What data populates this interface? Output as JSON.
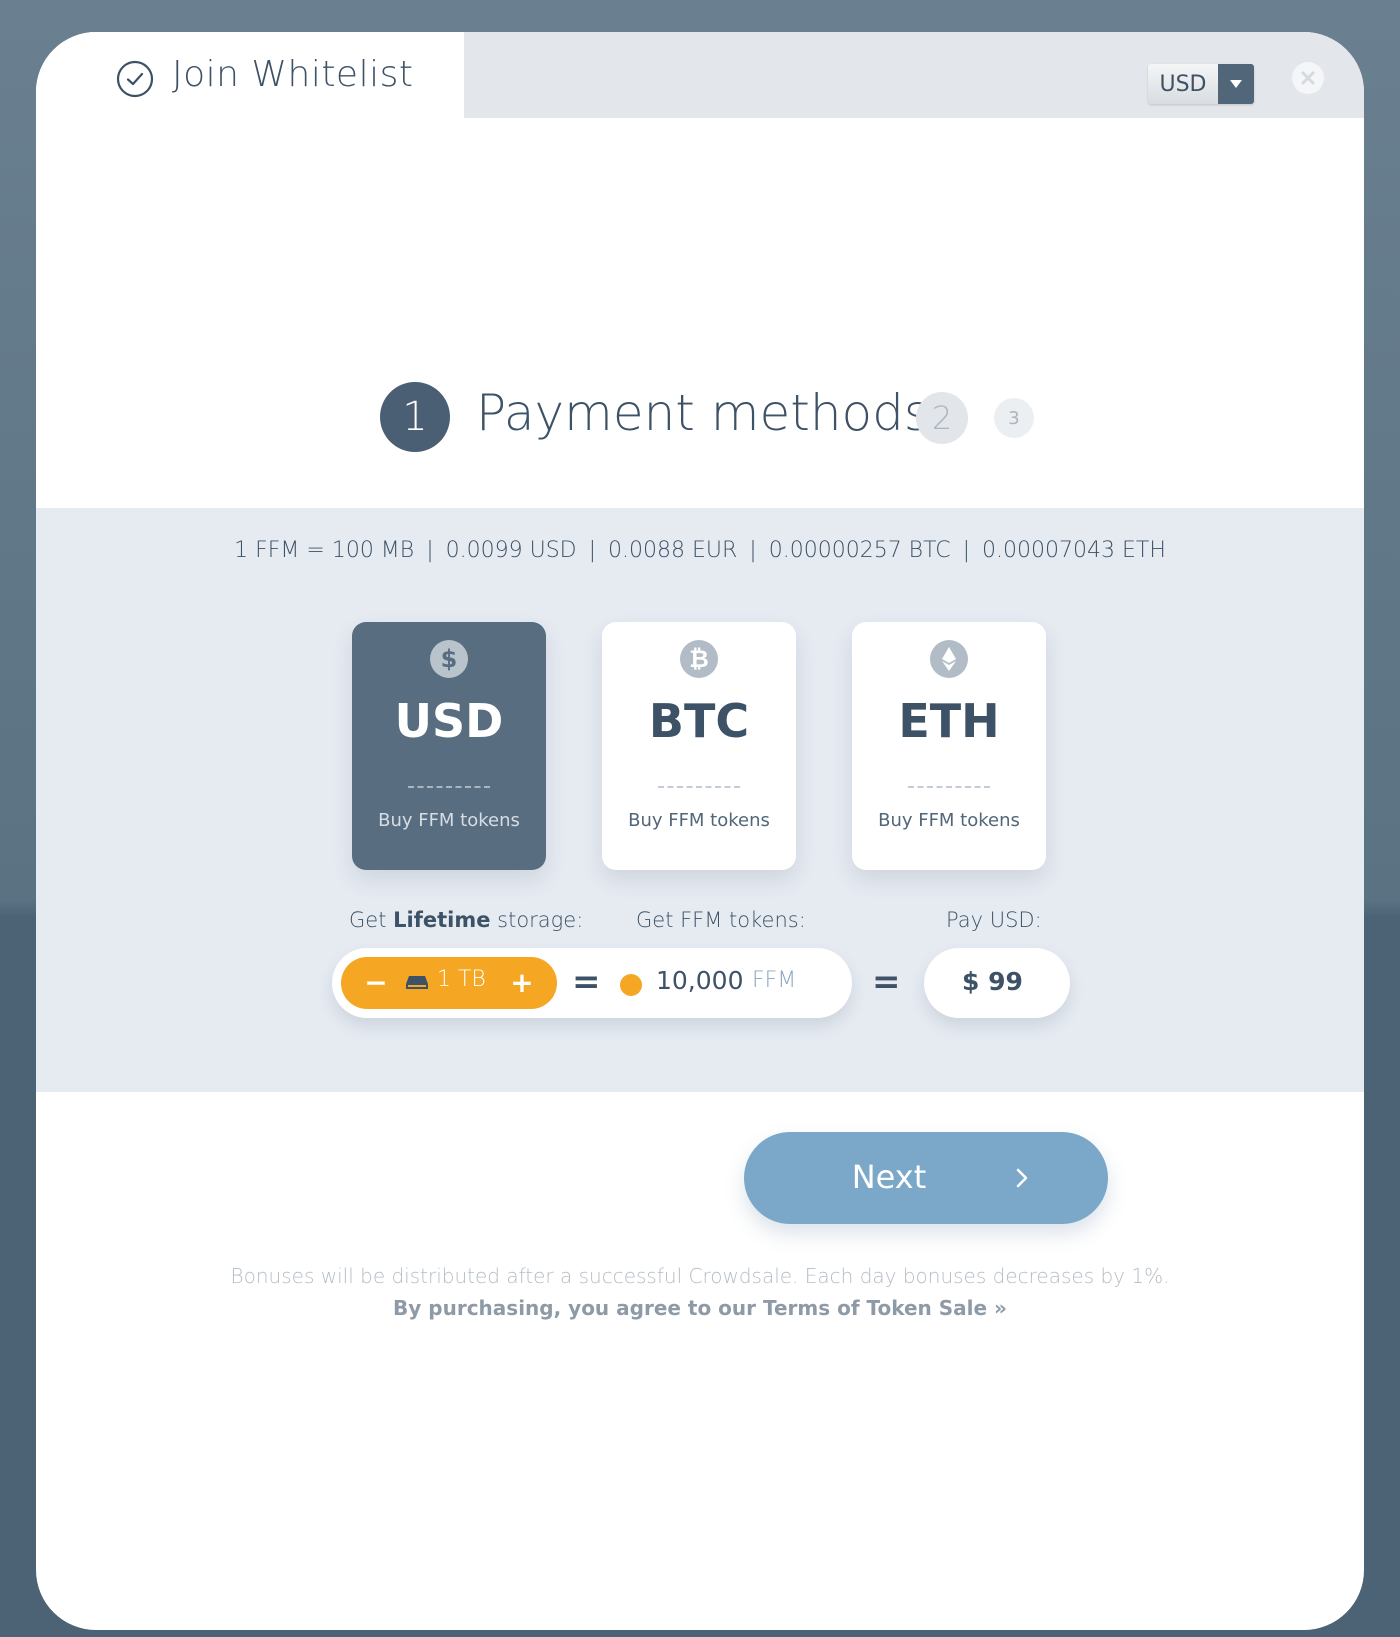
{
  "header": {
    "title": "Join Whitelist",
    "currency_selected": "USD"
  },
  "steps": {
    "active_number": "1",
    "active_title": "Payment methods",
    "step2": "2",
    "step3": "3"
  },
  "rates": {
    "items": [
      "1 FFM = 100 MB",
      "0.0099 USD",
      "0.0088 EUR",
      "0.00000257 BTC",
      "0.00007043 ETH"
    ],
    "separator": "|"
  },
  "methods": [
    {
      "code": "USD",
      "icon": "dollar-coin-icon",
      "symbol": "$",
      "subtitle": "Buy FFM tokens",
      "selected": true
    },
    {
      "code": "BTC",
      "icon": "bitcoin-coin-icon",
      "symbol": "₿",
      "subtitle": "Buy FFM tokens",
      "selected": false
    },
    {
      "code": "ETH",
      "icon": "ethereum-coin-icon",
      "symbol": "",
      "subtitle": "Buy FFM tokens",
      "selected": false
    }
  ],
  "calculator": {
    "storage_label_prefix": "Get",
    "storage_label_bold": "Lifetime",
    "storage_label_suffix": "storage:",
    "tokens_label": "Get FFM tokens:",
    "pay_label": "Pay USD:",
    "minus": "−",
    "plus": "+",
    "storage_value": "1 TB",
    "equals": "=",
    "token_amount": "10,000",
    "token_unit": "FFM",
    "pay_amount": "$ 99"
  },
  "actions": {
    "next_label": "Next"
  },
  "footer": {
    "bonus_note": "Bonuses will be distributed after a successful Crowdsale. Each day bonuses decreases by 1%.",
    "terms_note": "By purchasing, you agree to our Terms of Token Sale »"
  },
  "colors": {
    "accent_orange": "#f5a623",
    "primary_dark": "#4a5f73",
    "next_button": "#7ba8c9",
    "band_background": "#e6ebf2"
  }
}
